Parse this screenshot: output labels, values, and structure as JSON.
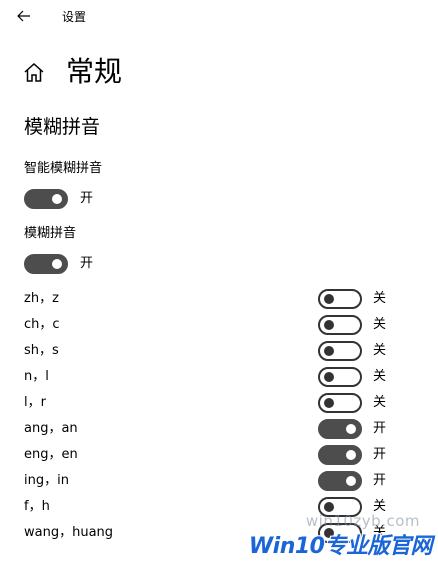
{
  "titlebar": {
    "back_icon": "arrow-left-icon",
    "title": "设置"
  },
  "page": {
    "home_icon": "home-icon",
    "title": "常规",
    "section_title": "模糊拼音"
  },
  "smart_fuzzy": {
    "label": "智能模糊拼音",
    "state": "开",
    "on": true
  },
  "fuzzy": {
    "label": "模糊拼音",
    "state": "开",
    "on": true
  },
  "pairs": [
    {
      "label": "zh，z",
      "state": "关",
      "on": false
    },
    {
      "label": "ch，c",
      "state": "关",
      "on": false
    },
    {
      "label": "sh，s",
      "state": "关",
      "on": false
    },
    {
      "label": "n，l",
      "state": "关",
      "on": false
    },
    {
      "label": "l，r",
      "state": "关",
      "on": false
    },
    {
      "label": "ang，an",
      "state": "开",
      "on": true
    },
    {
      "label": "eng，en",
      "state": "开",
      "on": true
    },
    {
      "label": "ing，in",
      "state": "开",
      "on": true
    },
    {
      "label": "f，h",
      "state": "关",
      "on": false
    },
    {
      "label": "wang，huang",
      "state": "关",
      "on": false
    }
  ],
  "watermark": {
    "url": "win10zyb.com",
    "brand": "Win10专业版官网"
  },
  "colors": {
    "toggle_on": "#4d4d4d",
    "toggle_off_border": "#333333",
    "watermark_brand": "#1a66d9"
  }
}
